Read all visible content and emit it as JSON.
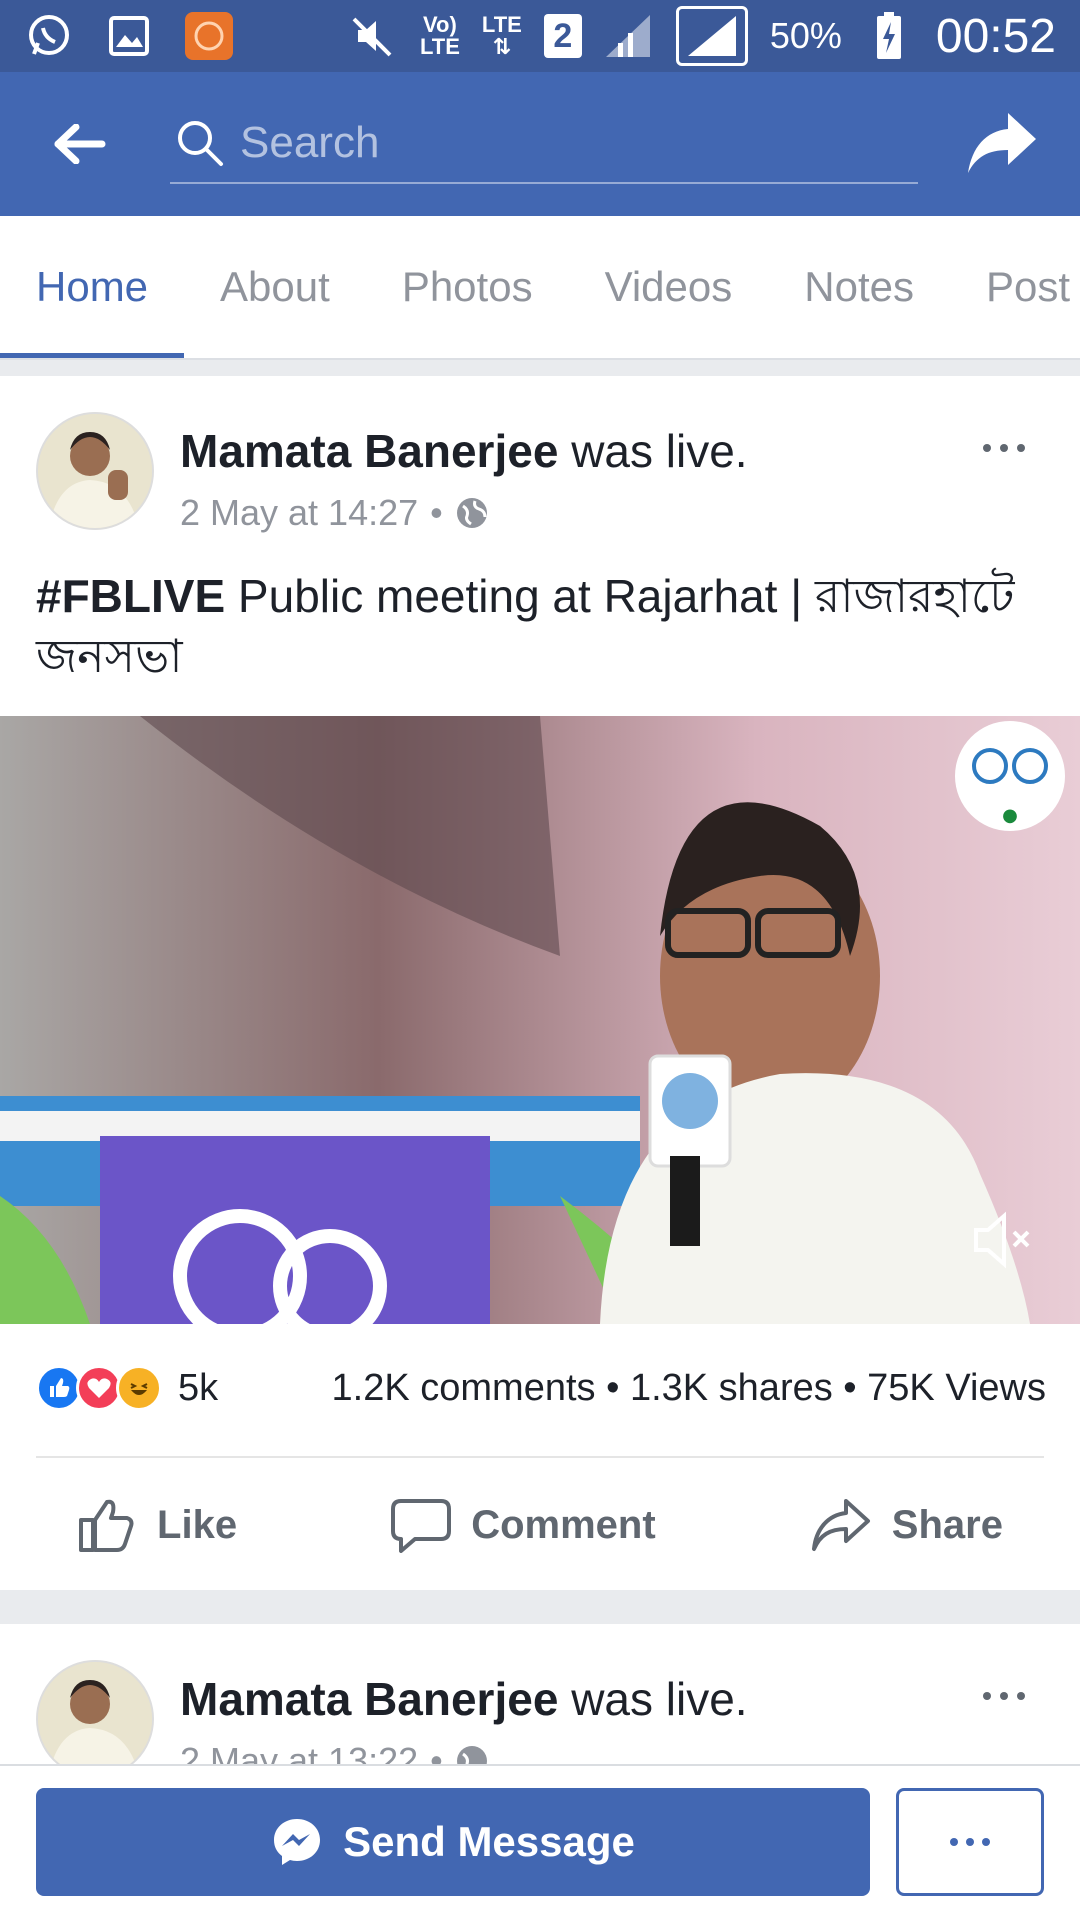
{
  "status_bar": {
    "network_label_top": "Vo)",
    "network_label_bottom": "LTE",
    "lte_label": "LTE",
    "sim_number": "2",
    "battery": "50%",
    "time": "00:52",
    "icons": [
      "whatsapp-icon",
      "gallery-icon",
      "mi-app-icon",
      "mute-icon",
      "signal-icon",
      "battery-icon"
    ]
  },
  "app_bar": {
    "search_placeholder": "Search"
  },
  "tabs": [
    {
      "label": "Home",
      "active": true
    },
    {
      "label": "About",
      "active": false
    },
    {
      "label": "Photos",
      "active": false
    },
    {
      "label": "Videos",
      "active": false
    },
    {
      "label": "Notes",
      "active": false
    },
    {
      "label": "Post",
      "active": false
    }
  ],
  "post": {
    "author": "Mamata Banerjee",
    "action": "was live.",
    "timestamp": "2 May at 14:27",
    "separator": "•",
    "hashtag": "#FBLIVE",
    "text_rest": " Public meeting at Rajarhat | রাজারহাটে জনসভা",
    "reaction_count": "5k",
    "stats": "1.2K comments • 1.3K shares • 75K Views",
    "actions": {
      "like": "Like",
      "comment": "Comment",
      "share": "Share"
    }
  },
  "post2": {
    "author": "Mamata Banerjee",
    "action": "was live.",
    "timestamp": "2 May at 13:22",
    "separator": "•"
  },
  "bottom_bar": {
    "send_message": "Send Message"
  },
  "colors": {
    "brand": "#4267b2",
    "status_bar": "#3b5998",
    "like_blue": "#1877f2",
    "love_red": "#f33e58",
    "haha_yellow": "#f7b125"
  }
}
